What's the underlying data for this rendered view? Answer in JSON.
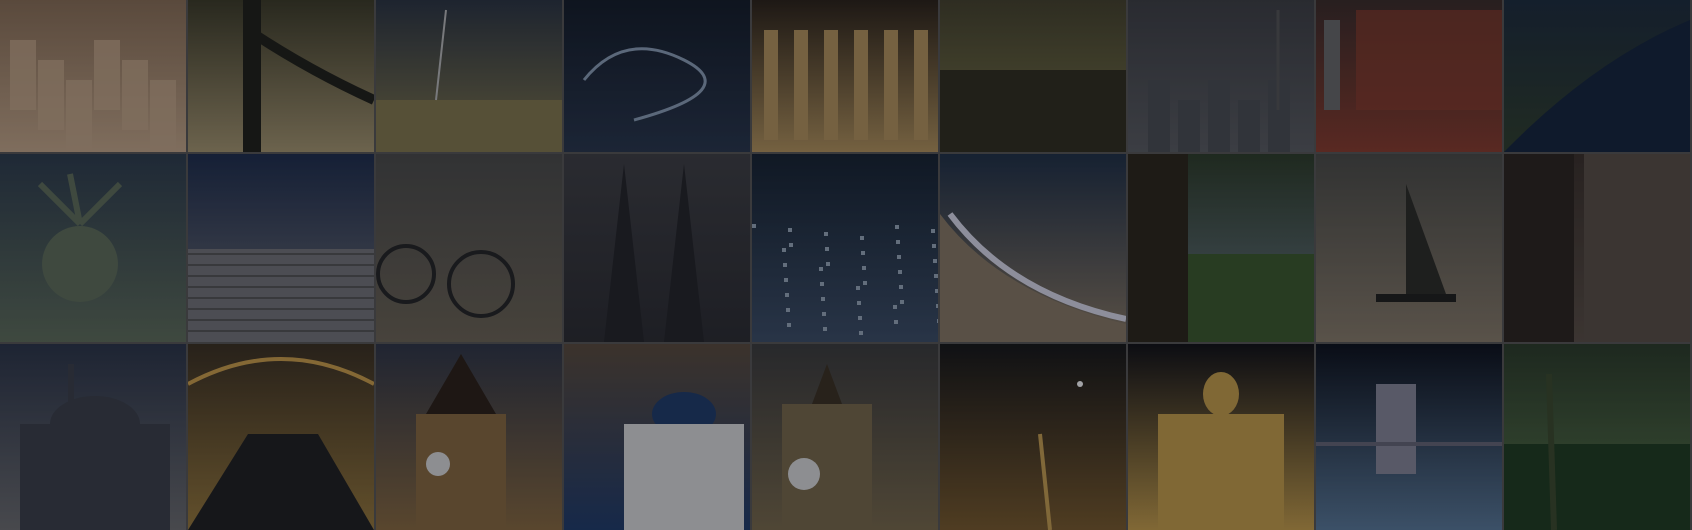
{
  "tiles": [
    {
      "id": "santorini-village",
      "icon": "village-icon",
      "colors": [
        "#8b6f55",
        "#c7a98a"
      ]
    },
    {
      "id": "bridge-over-river",
      "icon": "bridge-icon",
      "colors": [
        "#3c3a25",
        "#a89870"
      ]
    },
    {
      "id": "wheat-field-pylon",
      "icon": "pylon-icon",
      "colors": [
        "#2a3340",
        "#857a4c"
      ]
    },
    {
      "id": "boat-wake-sea",
      "icon": "boat-icon",
      "colors": [
        "#121a26",
        "#27344a"
      ]
    },
    {
      "id": "temple-columns",
      "icon": "columns-icon",
      "colors": [
        "#2a2015",
        "#b6955c"
      ]
    },
    {
      "id": "pond-trees",
      "icon": "pond-icon",
      "colors": [
        "#45412a",
        "#7d7a47"
      ]
    },
    {
      "id": "foggy-skyline",
      "icon": "skyline-icon",
      "colors": [
        "#3d3e42",
        "#5a5c60"
      ]
    },
    {
      "id": "train-motion-blur",
      "icon": "train-icon",
      "colors": [
        "#3a2a26",
        "#8a3a2a"
      ]
    },
    {
      "id": "forest-river",
      "icon": "river-icon",
      "colors": [
        "#1b2a3a",
        "#2f3e2b"
      ]
    },
    {
      "id": "statue-of-liberty",
      "icon": "statue-icon",
      "colors": [
        "#2c3b4b",
        "#5f6e5a"
      ]
    },
    {
      "id": "plowed-field",
      "icon": "field-icon",
      "colors": [
        "#1c2b4a",
        "#75757a"
      ]
    },
    {
      "id": "bicycle-street",
      "icon": "bicycle-icon",
      "colors": [
        "#4a4a48",
        "#6d6454"
      ]
    },
    {
      "id": "gothic-cathedral",
      "icon": "cathedral-icon",
      "colors": [
        "#3e3e42",
        "#2a2a2e"
      ]
    },
    {
      "id": "city-night-aerial",
      "icon": "city-icon",
      "colors": [
        "#14202e",
        "#3b4d66"
      ]
    },
    {
      "id": "ocean-shore",
      "icon": "waves-icon",
      "colors": [
        "#1e2e44",
        "#8a7a64"
      ]
    },
    {
      "id": "tree-trunk-meadow",
      "icon": "tree-icon",
      "colors": [
        "#2c3b26",
        "#6d7d8a"
      ]
    },
    {
      "id": "sailboat-sea",
      "icon": "sailboat-icon",
      "colors": [
        "#4a4a45",
        "#8a7d6a"
      ]
    },
    {
      "id": "skyscrapers-upward",
      "icon": "skyscraper-icon",
      "colors": [
        "#3a2f28",
        "#5a4e44"
      ]
    },
    {
      "id": "mosque-domes",
      "icon": "mosque-icon",
      "colors": [
        "#2a3346",
        "#6e6e70"
      ]
    },
    {
      "id": "tunnel-lights",
      "icon": "tunnel-icon",
      "colors": [
        "#3a2e1e",
        "#9a7a3a"
      ]
    },
    {
      "id": "clock-tower-graz",
      "icon": "clocktower-icon",
      "colors": [
        "#2e3444",
        "#8a6a3e"
      ]
    },
    {
      "id": "santorini-blue-dome",
      "icon": "dome-icon",
      "colors": [
        "#5a4a3a",
        "#1e3a6a"
      ]
    },
    {
      "id": "big-ben",
      "icon": "bigben-icon",
      "colors": [
        "#3a3a3a",
        "#7a6a4a"
      ]
    },
    {
      "id": "city-night-street",
      "icon": "nightstreet-icon",
      "colors": [
        "#141414",
        "#7a5a2a"
      ]
    },
    {
      "id": "cathedral-night-lit",
      "icon": "golden-cathedral-icon",
      "colors": [
        "#0e0e12",
        "#c9a04a"
      ]
    },
    {
      "id": "chain-bridge-night",
      "icon": "suspension-bridge-icon",
      "colors": [
        "#0a0e18",
        "#5a7a9a"
      ]
    },
    {
      "id": "palm-trees",
      "icon": "palm-icon",
      "colors": [
        "#2a3a26",
        "#5a7a4a"
      ]
    }
  ]
}
